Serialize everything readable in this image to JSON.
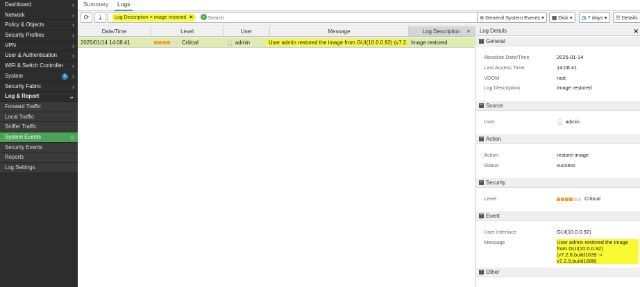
{
  "sidebar": {
    "items": [
      {
        "label": "Dashboard",
        "chev": "›"
      },
      {
        "label": "Network",
        "chev": "›"
      },
      {
        "label": "Policy & Objects",
        "chev": "›"
      },
      {
        "label": "Security Profiles",
        "chev": "›"
      },
      {
        "label": "VPN",
        "chev": "›"
      },
      {
        "label": "User & Authentication",
        "chev": "›"
      },
      {
        "label": "WiFi & Switch Controller",
        "chev": "›"
      },
      {
        "label": "System",
        "chev": "›",
        "badge": "1"
      },
      {
        "label": "Security Fabric",
        "chev": "›"
      },
      {
        "label": "Log & Report",
        "chev": "⌄"
      }
    ],
    "subitems": [
      {
        "label": "Forward Traffic"
      },
      {
        "label": "Local Traffic"
      },
      {
        "label": "Sniffer Traffic"
      },
      {
        "label": "System Events",
        "star": "☆"
      },
      {
        "label": "Security Events"
      },
      {
        "label": "Reports"
      },
      {
        "label": "Log Settings"
      }
    ]
  },
  "tabs": [
    {
      "label": "Summary"
    },
    {
      "label": "Logs"
    }
  ],
  "toolbar": {
    "refresh_icon": "⟳",
    "download_icon": "⤓",
    "filter_chip": "Log Description = image restored",
    "filter_chip_close": "✕",
    "add_filter": "+",
    "search_placeholder": "Search",
    "search_icon": "⌕",
    "source_dropdown": "General System Events ▾",
    "source_icon": "⊕",
    "disk_dropdown": "Disk ▾",
    "disk_icon": "▤",
    "time_dropdown": "7 days ▾",
    "time_icon": "◷",
    "details_button": "Details",
    "details_icon": "☰"
  },
  "table": {
    "columns": [
      "Date/Time",
      "Level",
      "User",
      "Message",
      "Log Description"
    ],
    "rows": [
      {
        "datetime": "2025/01/14 14:08:41",
        "level": "Critical",
        "user": "admin",
        "message": "User admin restored the image from GUI(10.0.0.92) (v7.2....",
        "log_description": "Image restored"
      }
    ]
  },
  "details": {
    "title": "Log Details",
    "close": "✕",
    "sections": {
      "general": "General",
      "source": "Source",
      "action": "Action",
      "security": "Security",
      "event": "Event",
      "other": "Other"
    },
    "fields": {
      "absolute_datetime_label": "Absolute Date/Time",
      "absolute_datetime": "2025-01-14",
      "last_access_label": "Last Access Time",
      "last_access": "14:08:41",
      "vdom_label": "VDOM",
      "vdom": "root",
      "log_desc_label": "Log Description",
      "log_desc": "Image restored",
      "user_label": "User",
      "user": "admin",
      "action_label": "Action",
      "action": "restore-image",
      "status_label": "Status",
      "status": "success",
      "level_label": "Level",
      "level": "Critical",
      "ui_label": "User Interface",
      "ui": "GUI(10.0.0.92)",
      "message_label": "Message",
      "message": "User admin restored the image from GUI(10.0.0.92) (v7.2.8,build1639 -> v7.2.9,build1688)"
    }
  },
  "colors": {
    "accent_green": "#4ba355",
    "highlight_yellow": "#fafa32",
    "level_filled": "#f0a030",
    "level_empty": "#dddddd"
  },
  "level_scale": {
    "filled": 4,
    "total": 6
  }
}
